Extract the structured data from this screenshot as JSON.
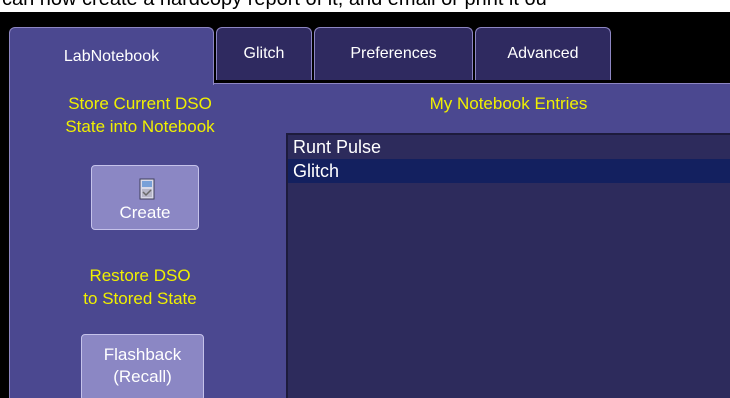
{
  "caption_fragment": "can now create a hardcopy report of it, and email or print it ou",
  "tabs": [
    {
      "label": "LabNotebook",
      "active": true
    },
    {
      "label": "Glitch",
      "active": false
    },
    {
      "label": "Preferences",
      "active": false
    },
    {
      "label": "Advanced",
      "active": false
    }
  ],
  "left_panel": {
    "store_title_line1": "Store Current DSO",
    "store_title_line2": "State into Notebook",
    "create_button": {
      "label": "Create",
      "icon": "notebook-save-icon"
    },
    "restore_title_line1": "Restore DSO",
    "restore_title_line2": "to Stored State",
    "flashback_button": {
      "line1": "Flashback",
      "line2": "(Recall)"
    }
  },
  "entries": {
    "title": "My Notebook Entries",
    "items": [
      {
        "label": "Runt Pulse",
        "selected": false
      },
      {
        "label": "Glitch",
        "selected": true
      }
    ]
  },
  "colors": {
    "panel_background": "#4b4890",
    "tab_background": "#2f2a60",
    "label_yellow": "#f0f000",
    "list_background": "#2d2b5c",
    "selected_row": "#13205f",
    "button_background": "#8b87c4"
  }
}
